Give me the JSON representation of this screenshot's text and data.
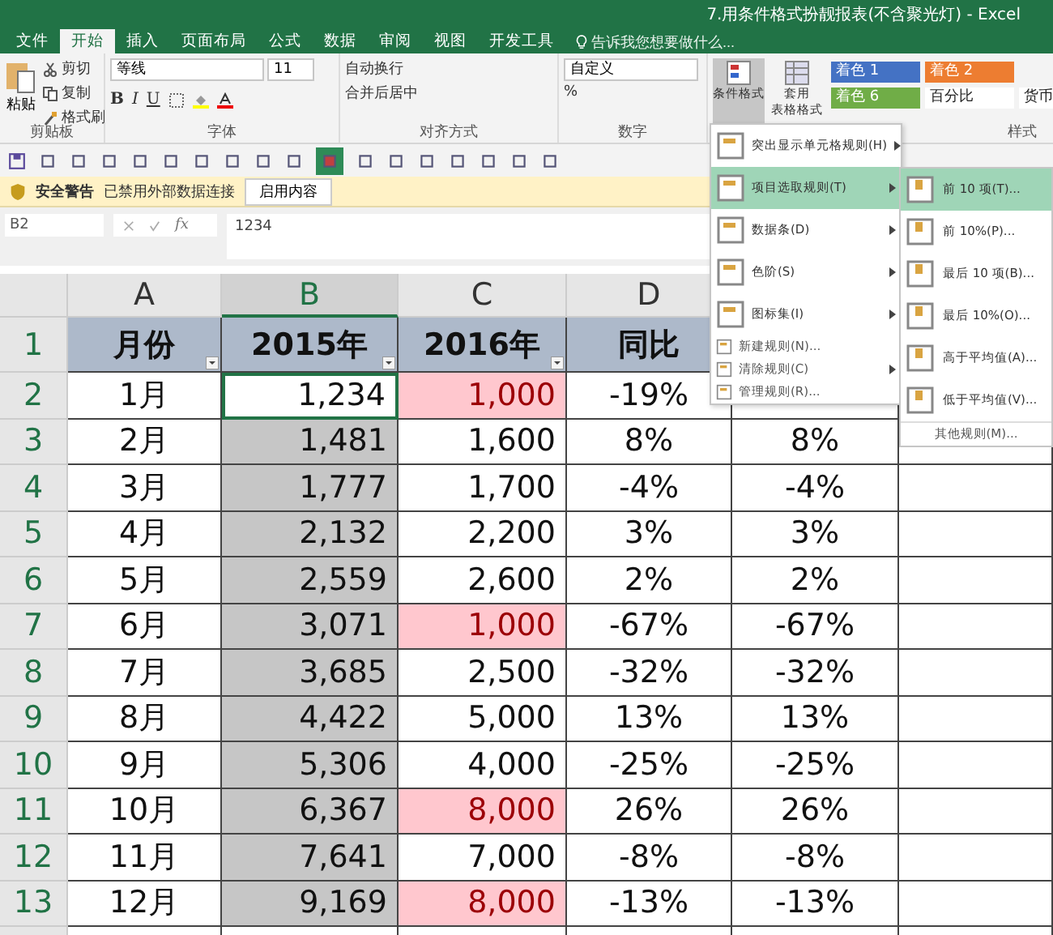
{
  "window": {
    "title": "7.用条件格式扮靓报表(不含聚光灯) - Excel"
  },
  "tabs": [
    {
      "label": "文件",
      "selected": false
    },
    {
      "label": "开始",
      "selected": true
    },
    {
      "label": "插入",
      "selected": false
    },
    {
      "label": "页面布局",
      "selected": false
    },
    {
      "label": "公式",
      "selected": false
    },
    {
      "label": "数据",
      "selected": false
    },
    {
      "label": "审阅",
      "selected": false
    },
    {
      "label": "视图",
      "selected": false
    },
    {
      "label": "开发工具",
      "selected": false
    }
  ],
  "tell_me": {
    "placeholder": "告诉我您想要做什么..."
  },
  "ribbon": {
    "clipboard": {
      "paste": "粘贴",
      "cut": "剪切",
      "copy": "复制",
      "format_painter": "格式刷",
      "group": "剪贴板"
    },
    "font": {
      "name": "等线",
      "size": "11",
      "bold": "B",
      "italic": "I",
      "underline": "U",
      "group": "字体"
    },
    "alignment": {
      "wrap": "自动换行",
      "merge": "合并后居中",
      "group": "对齐方式"
    },
    "number": {
      "format": "自定义",
      "percent": "%",
      "group": "数字"
    },
    "styles": {
      "conditional": "条件格式",
      "table_line_1": "套用",
      "table_line_2": "表格格式",
      "group": "样式",
      "gallery": [
        {
          "label": "着色 1",
          "color": "#4472c4"
        },
        {
          "label": "着色 2",
          "color": "#ed7d31"
        },
        {
          "label": "着色 6",
          "color": "#70ad47"
        },
        {
          "label": "百分比",
          "color": "#ffffff"
        },
        {
          "label": "货币",
          "color": "#ffffff"
        }
      ]
    }
  },
  "security_bar": {
    "title": "安全警告",
    "message": "已禁用外部数据连接",
    "button": "启用内容"
  },
  "formula_bar": {
    "name_box": "B2",
    "fx": "fx",
    "formula": "1234"
  },
  "columns": [
    {
      "label": "A",
      "selected": false
    },
    {
      "label": "B",
      "selected": true
    },
    {
      "label": "C",
      "selected": false
    },
    {
      "label": "D",
      "selected": false
    }
  ],
  "rows": [
    {
      "num": "1",
      "cells": [
        {
          "text": "月份"
        },
        {
          "text": "2015年"
        },
        {
          "text": "2016年"
        },
        {
          "text": "同比"
        }
      ]
    },
    {
      "num": "2",
      "cells": [
        {
          "text": "1月"
        },
        {
          "text": "1,234",
          "active": true
        },
        {
          "text": "1,000",
          "highlight": true
        },
        {
          "text": "-19%"
        }
      ]
    },
    {
      "num": "3",
      "cells": [
        {
          "text": "2月"
        },
        {
          "text": "1,481"
        },
        {
          "text": "1,600"
        },
        {
          "text": "8%"
        },
        {
          "text": "8%"
        }
      ]
    },
    {
      "num": "4",
      "cells": [
        {
          "text": "3月"
        },
        {
          "text": "1,777"
        },
        {
          "text": "1,700"
        },
        {
          "text": "-4%"
        },
        {
          "text": "-4%"
        }
      ]
    },
    {
      "num": "5",
      "cells": [
        {
          "text": "4月"
        },
        {
          "text": "2,132"
        },
        {
          "text": "2,200"
        },
        {
          "text": "3%"
        },
        {
          "text": "3%"
        }
      ]
    },
    {
      "num": "6",
      "cells": [
        {
          "text": "5月"
        },
        {
          "text": "2,559"
        },
        {
          "text": "2,600"
        },
        {
          "text": "2%"
        },
        {
          "text": "2%"
        }
      ]
    },
    {
      "num": "7",
      "cells": [
        {
          "text": "6月"
        },
        {
          "text": "3,071"
        },
        {
          "text": "1,000",
          "highlight": true
        },
        {
          "text": "-67%"
        },
        {
          "text": "-67%"
        }
      ]
    },
    {
      "num": "8",
      "cells": [
        {
          "text": "7月"
        },
        {
          "text": "3,685"
        },
        {
          "text": "2,500"
        },
        {
          "text": "-32%"
        },
        {
          "text": "-32%"
        }
      ]
    },
    {
      "num": "9",
      "cells": [
        {
          "text": "8月"
        },
        {
          "text": "4,422"
        },
        {
          "text": "5,000"
        },
        {
          "text": "13%"
        },
        {
          "text": "13%"
        }
      ]
    },
    {
      "num": "10",
      "cells": [
        {
          "text": "9月"
        },
        {
          "text": "5,306"
        },
        {
          "text": "4,000"
        },
        {
          "text": "-25%"
        },
        {
          "text": "-25%"
        }
      ]
    },
    {
      "num": "11",
      "cells": [
        {
          "text": "10月"
        },
        {
          "text": "6,367"
        },
        {
          "text": "8,000",
          "highlight": true
        },
        {
          "text": "26%"
        },
        {
          "text": "26%"
        }
      ]
    },
    {
      "num": "12",
      "cells": [
        {
          "text": "11月"
        },
        {
          "text": "7,641"
        },
        {
          "text": "7,000"
        },
        {
          "text": "-8%"
        },
        {
          "text": "-8%"
        }
      ]
    },
    {
      "num": "13",
      "cells": [
        {
          "text": "12月"
        },
        {
          "text": "9,169"
        },
        {
          "text": "8,000",
          "highlight": true
        },
        {
          "text": "-13%"
        },
        {
          "text": "-13%"
        }
      ]
    }
  ],
  "menu": {
    "items": [
      {
        "kind": "big",
        "label": "突出显示单元格规则(H)",
        "submenu": true,
        "selected": false
      },
      {
        "kind": "big",
        "label": "项目选取规则(T)",
        "submenu": true,
        "selected": true
      },
      {
        "kind": "big",
        "label": "数据条(D)",
        "submenu": true,
        "selected": false
      },
      {
        "kind": "big",
        "label": "色阶(S)",
        "submenu": true,
        "selected": false
      },
      {
        "kind": "big",
        "label": "图标集(I)",
        "submenu": true,
        "selected": false
      },
      {
        "kind": "small",
        "label": "新建规则(N)...",
        "submenu": false,
        "selected": false
      },
      {
        "kind": "small",
        "label": "清除规则(C)",
        "submenu": true,
        "selected": false
      },
      {
        "kind": "small",
        "label": "管理规则(R)...",
        "submenu": false,
        "selected": false
      }
    ],
    "submenu": [
      {
        "label": "前 10 项(T)...",
        "selected": true
      },
      {
        "label": "前 10%(P)...",
        "selected": false
      },
      {
        "label": "最后 10 项(B)...",
        "selected": false
      },
      {
        "label": "最后 10%(O)...",
        "selected": false
      },
      {
        "label": "高于平均值(A)...",
        "selected": false
      },
      {
        "label": "低于平均值(V)...",
        "selected": false
      }
    ],
    "more": "其他规则(M)..."
  }
}
